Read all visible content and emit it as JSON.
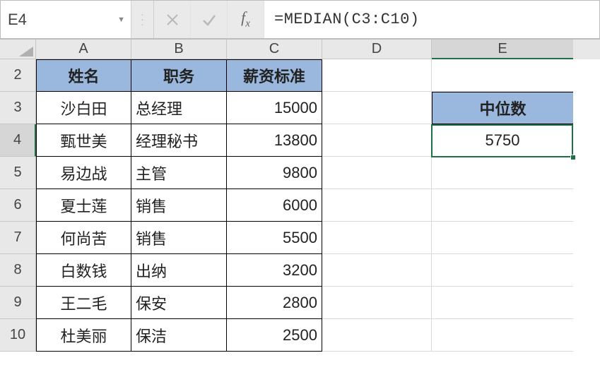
{
  "formula_bar": {
    "cell_ref": "E4",
    "formula": "=MEDIAN(C3:C10)"
  },
  "columns": [
    "A",
    "B",
    "C",
    "D",
    "E"
  ],
  "row_numbers": [
    2,
    3,
    4,
    5,
    6,
    7,
    8,
    9,
    10
  ],
  "selected": {
    "col": "E",
    "row": 4
  },
  "table_headers": {
    "A": "姓名",
    "B": "职务",
    "C": "薪资标准"
  },
  "rows": [
    {
      "name": "沙白田",
      "role": "总经理",
      "salary": "15000"
    },
    {
      "name": "甄世美",
      "role": "经理秘书",
      "salary": "13800"
    },
    {
      "name": "易边战",
      "role": "主管",
      "salary": "9800"
    },
    {
      "name": "夏士莲",
      "role": "销售",
      "salary": "6000"
    },
    {
      "name": "何尚苦",
      "role": "销售",
      "salary": "5500"
    },
    {
      "name": "白数钱",
      "role": "出纳",
      "salary": "3200"
    },
    {
      "name": "王二毛",
      "role": "保安",
      "salary": "2800"
    },
    {
      "name": "杜美丽",
      "role": "保洁",
      "salary": "2500"
    }
  ],
  "median_box": {
    "label": "中位数",
    "value": "5750"
  },
  "colors": {
    "header_bg": "#9ab7de",
    "selection": "#1f7044"
  }
}
